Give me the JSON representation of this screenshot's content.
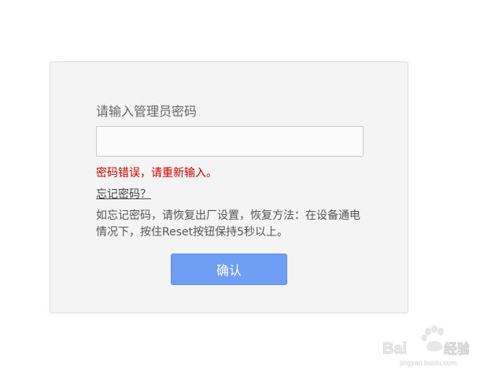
{
  "login_form": {
    "title": "请输入管理员密码",
    "password_value": "",
    "password_placeholder": "",
    "error_message": "密码错误，请重新输入。",
    "forgot_link": "忘记密码？",
    "help_text": "如忘记密码，请恢复出厂设置，恢复方法：在设备通电情况下，按住Reset按钮保持5秒以上。",
    "confirm_label": "确认"
  },
  "watermark": {
    "brand": "Baidu经验",
    "url": "jingyan.baidu.com"
  },
  "colors": {
    "error": "#cc0000",
    "button": "#6f9ff5",
    "panel": "#f4f4f4"
  }
}
